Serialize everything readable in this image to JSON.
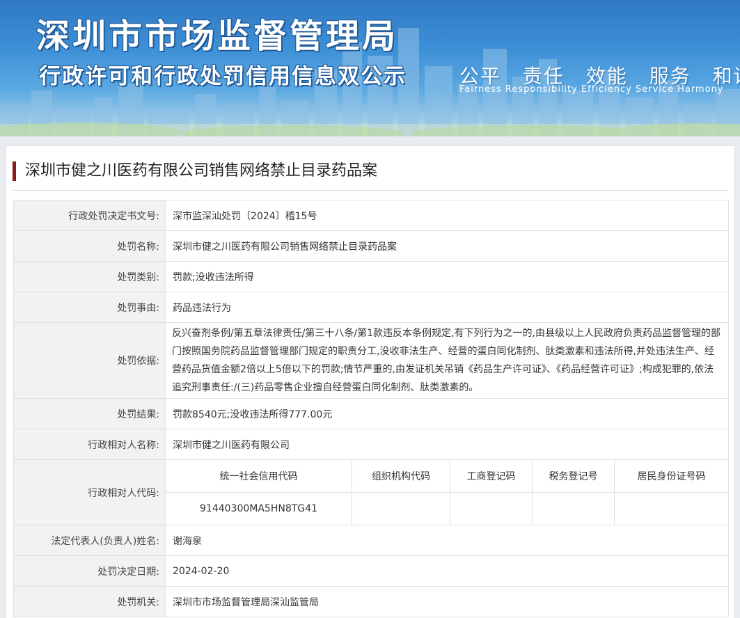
{
  "banner": {
    "title": "深圳市市场监督管理局",
    "subtitle": "行政许可和行政处罚信用信息双公示",
    "slogans_cn": [
      "公平",
      "责任",
      "效能",
      "服务",
      "和谐"
    ],
    "slogan_en": "Fairness  Responsibility  Efficiency  Service  Harmony"
  },
  "case_title": "深圳市健之川医药有限公司销售网络禁止目录药品案",
  "rows": [
    {
      "label": "行政处罚决定书文号:",
      "value": "深市监深汕处罚〔2024〕稽15号"
    },
    {
      "label": "处罚名称:",
      "value": "深圳市健之川医药有限公司销售网络禁止目录药品案"
    },
    {
      "label": "处罚类别:",
      "value": "罚款;没收违法所得"
    },
    {
      "label": "处罚事由:",
      "value": "药品违法行为"
    },
    {
      "label": "处罚依据:",
      "value": "反兴奋剂条例/第五章法律责任/第三十八条/第1款违反本条例规定,有下列行为之一的,由县级以上人民政府负责药品监督管理的部门按照国务院药品监督管理部门规定的职责分工,没收非法生产、经营的蛋白同化制剂、肽类激素和违法所得,并处违法生产、经营药品货值金额2倍以上5倍以下的罚款;情节严重的,由发证机关吊销《药品生产许可证》、《药品经营许可证》;构成犯罪的,依法追究刑事责任:/(三)药品零售企业擅自经营蛋白同化制剂、肽类激素的。"
    },
    {
      "label": "处罚结果:",
      "value": "罚款8540元;没收违法所得777.00元"
    },
    {
      "label": "行政相对人名称:",
      "value": "深圳市健之川医药有限公司"
    }
  ],
  "code_row": {
    "label": "行政相对人代码:",
    "headers": [
      "统一社会信用代码",
      "组织机构代码",
      "工商登记码",
      "税务登记号",
      "居民身份证号码"
    ],
    "values": [
      "91440300MA5HN8TG41",
      "",
      "",
      "",
      ""
    ]
  },
  "rows_after": [
    {
      "label": "法定代表人(负责人)姓名:",
      "value": "谢海泉"
    },
    {
      "label": "处罚决定日期:",
      "value": "2024-02-20"
    },
    {
      "label": "处罚机关:",
      "value": "深圳市市场监督管理局深汕监管局"
    }
  ],
  "colors": {
    "title_accent": "#8b1a1a",
    "label_bg": "#f2f2f2",
    "border": "#dfdfdf",
    "banner_blue": "#3d8fd6"
  }
}
